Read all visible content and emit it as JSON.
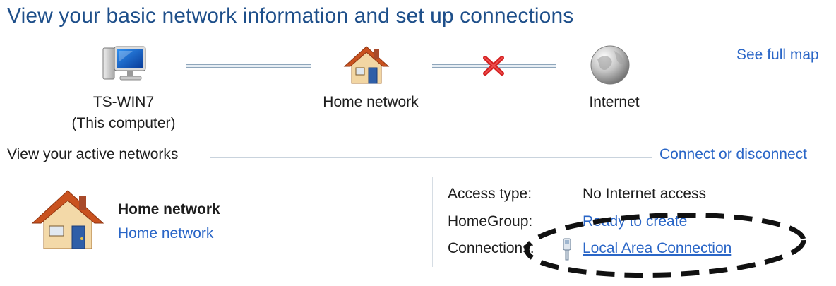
{
  "page_title": "View your basic network information and set up connections",
  "map": {
    "see_full_map": "See full map",
    "computer": {
      "name": "TS-WIN7",
      "subtitle": "(This computer)"
    },
    "network": {
      "name": "Home network"
    },
    "internet": {
      "name": "Internet"
    },
    "status_internet": "disconnected"
  },
  "active_networks": {
    "header": "View your active networks",
    "connect_link": "Connect or disconnect",
    "network_name": "Home network",
    "network_type": "Home network",
    "info": {
      "access_type_label": "Access type:",
      "access_type_value": "No Internet access",
      "homegroup_label": "HomeGroup:",
      "homegroup_value": "Ready to create",
      "connections_label": "Connections:",
      "connections_value": "Local Area Connection"
    }
  },
  "colors": {
    "title": "#1e4f8a",
    "link": "#2a66c7",
    "error_x": "#d42020"
  }
}
